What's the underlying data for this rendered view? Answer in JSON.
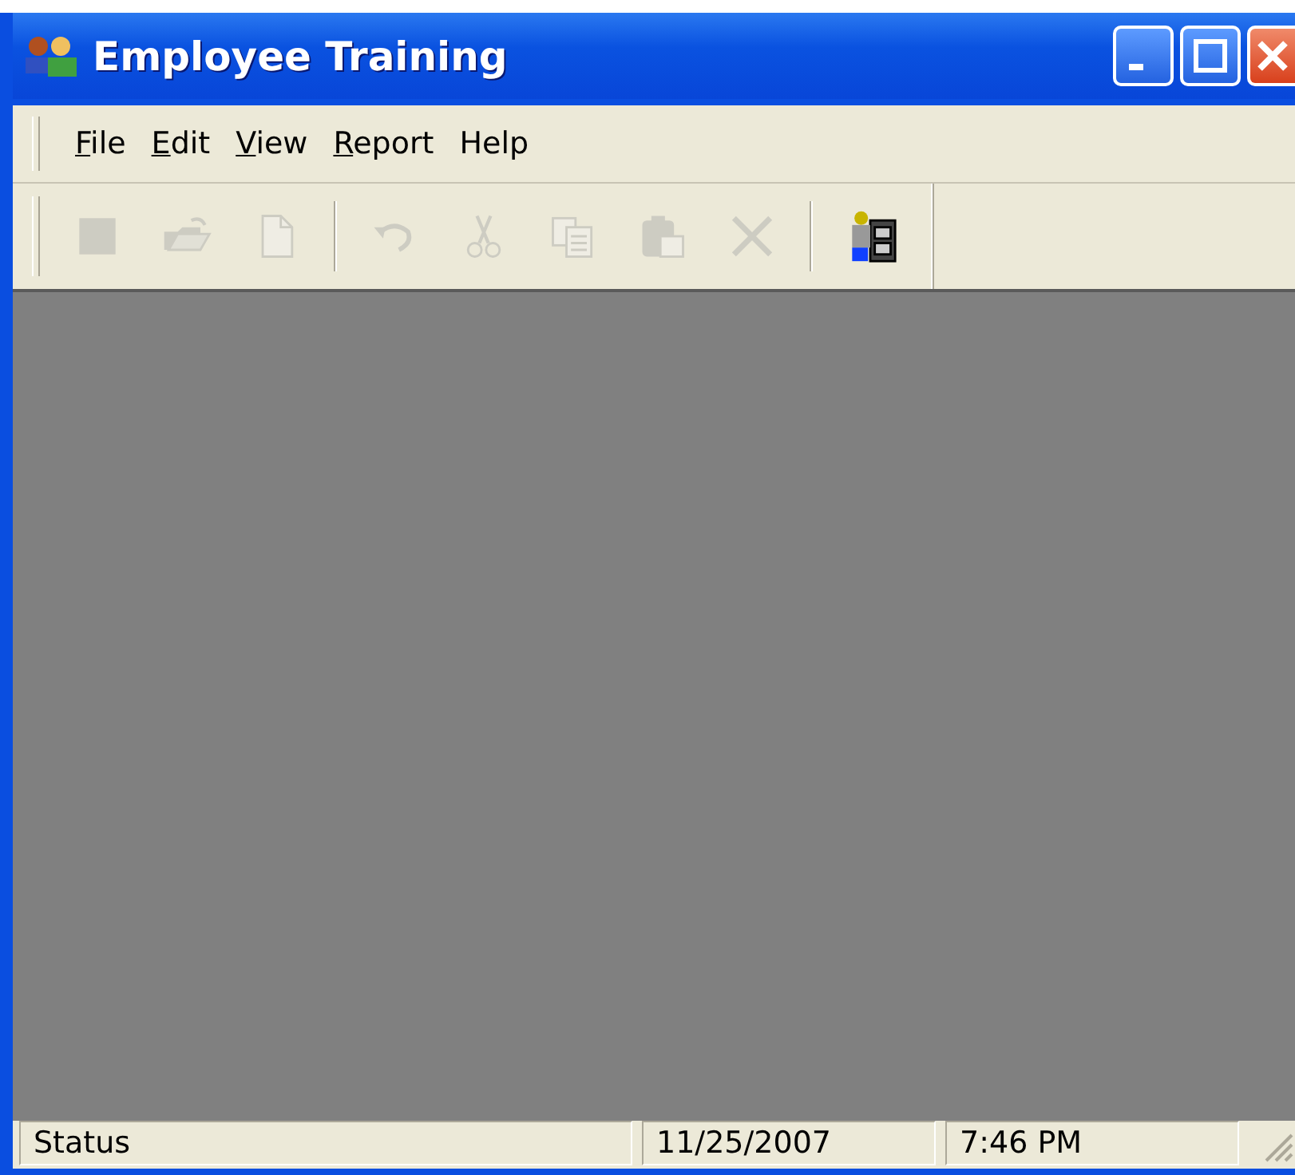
{
  "window": {
    "title": "Employee Training"
  },
  "menu": [
    {
      "label": "File",
      "underline_first": true
    },
    {
      "label": "Edit",
      "underline_first": true
    },
    {
      "label": "View",
      "underline_first": true
    },
    {
      "label": "Report",
      "underline_first": true
    },
    {
      "label": "Help",
      "underline_first": false
    }
  ],
  "toolbar": [
    {
      "kind": "stop",
      "disabled": true
    },
    {
      "kind": "open",
      "disabled": true
    },
    {
      "kind": "new",
      "disabled": true
    },
    {
      "kind": "separator"
    },
    {
      "kind": "undo",
      "disabled": true
    },
    {
      "kind": "cut",
      "disabled": true
    },
    {
      "kind": "copy",
      "disabled": true
    },
    {
      "kind": "paste",
      "disabled": true
    },
    {
      "kind": "delete",
      "disabled": true
    },
    {
      "kind": "separator"
    },
    {
      "kind": "worker",
      "disabled": false
    }
  ],
  "status_bar": [
    {
      "text": "Status"
    },
    {
      "text": "11/25/2007"
    },
    {
      "text": "7:46 PM"
    }
  ]
}
